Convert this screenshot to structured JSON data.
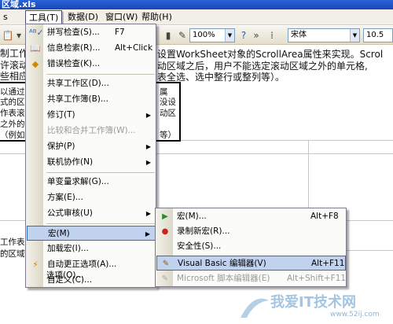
{
  "window": {
    "title": "区域.xls"
  },
  "menubar": {
    "items": [
      {
        "label": "s"
      },
      {
        "label": "工具(T)"
      },
      {
        "label": "数据(D)"
      },
      {
        "label": "窗口(W)"
      },
      {
        "label": "帮助(H)"
      }
    ]
  },
  "toolbar": {
    "zoom": "100%",
    "font_name": "宋体",
    "font_size": "10.5"
  },
  "sheet": {
    "line1": "设置WorkSheet对象的ScrollArea属性来实现。Scrol",
    "line2": "动区域之后，用户不能选定滚动区域之外的单元格,",
    "line3": "表全选、选中整行或整列等）。",
    "left_fragments": [
      "制工作",
      "许滚动",
      "些相应",
      "以通过",
      "式的区",
      "作表滚",
      "之外的",
      "（例如"
    ],
    "right_fragments": [
      "属",
      "没设",
      "动区",
      "等）"
    ],
    "lower_left": [
      "工作表",
      "的区域"
    ]
  },
  "tools_menu": {
    "items": [
      {
        "icon": "spellcheck-icon",
        "label": "拼写检查(S)...",
        "shortcut": "F7"
      },
      {
        "icon": "research-icon",
        "label": "信息检索(R)...",
        "shortcut": "Alt+Click"
      },
      {
        "icon": "error-check-icon",
        "label": "错误检查(K)..."
      },
      {
        "label": "共享工作区(D)..."
      },
      {
        "label": "共享工作簿(B)..."
      },
      {
        "label": "修订(T)"
      },
      {
        "label": "比较和合并工作簿(W)..."
      },
      {
        "label": "保护(P)"
      },
      {
        "label": "联机协作(N)"
      },
      {
        "label": "单变量求解(G)..."
      },
      {
        "label": "方案(E)..."
      },
      {
        "label": "公式审核(U)"
      },
      {
        "label": "宏(M)"
      },
      {
        "label": "加载宏(I)..."
      },
      {
        "icon": "autocorrect-icon",
        "label": "自动更正选项(A)..."
      },
      {
        "label": "自定义(C)..."
      },
      {
        "label": "选项(O)..."
      }
    ]
  },
  "macro_submenu": {
    "items": [
      {
        "icon": "run-macro-icon",
        "label": "宏(M)...",
        "shortcut": "Alt+F8"
      },
      {
        "icon": "record-icon",
        "label": "录制新宏(R)..."
      },
      {
        "icon": "security-icon",
        "label": "安全性(S)..."
      },
      {
        "icon": "vba-editor-icon",
        "label": "Visual Basic 编辑器(V)",
        "shortcut": "Alt+F11"
      },
      {
        "icon": "script-editor-icon",
        "label": "Microsoft 脚本编辑器(E)",
        "shortcut": "Alt+Shift+F11"
      }
    ]
  },
  "watermark": {
    "text": "我爱IT技术网",
    "url": "www.52ij.com"
  },
  "colors": {
    "menu_highlight": "#c1d2ee",
    "menu_border": "#316ac5",
    "titlebar": "#1747b8"
  }
}
